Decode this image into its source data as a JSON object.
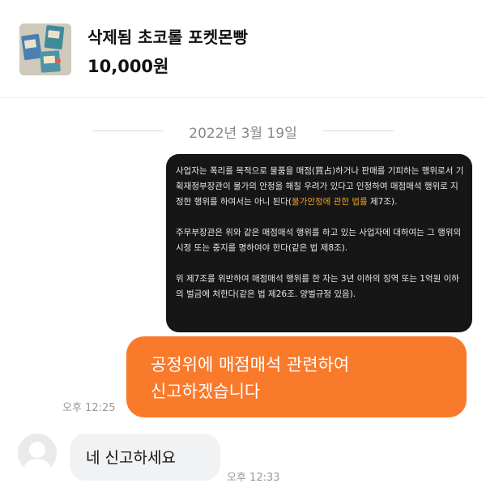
{
  "product": {
    "name": "삭제됨 초코롤 포켓몬빵",
    "price": "10,000원",
    "thumbnail_icon": "product-photo"
  },
  "chat": {
    "date": "2022년 3월 19일",
    "image_message": {
      "paragraph_1_text": "사업자는 폭리를 목적으로 물품을 매점(買占)하거나 판매를 기피하는 행위로서 기획재정부장관이 물가의 안정을 해칠 우려가 있다고 인정하여 매점매석 행위로 지정한 행위를 하여서는 아니 된다(",
      "paragraph_1_highlight": "물가안정에 관한 법률",
      "paragraph_1_end": " 제7조).",
      "paragraph_2": "주무부장관은 위와 같은 매점매석 행위를 하고 있는 사업자에 대하여는 그 행위의 시정 또는 중지를 명하여야 한다(같은 법 제8조).",
      "paragraph_3": "위 제7조를 위반하여 매점매석 행위를 한 자는 3년 이하의 징역 또는 1억원 이하의 벌금에 처한다(같은 법 제26조. 양벌규정 있음).",
      "highlight_color": "#f0a020"
    },
    "sent_message": {
      "line_1": "공정위에 매점매석 관련하여",
      "line_2": "신고하겠습니다",
      "time": "오후 12:25",
      "bubble_color": "#fa7a2b"
    },
    "received_message": {
      "text": "네 신고하세요",
      "time": "오후 12:33",
      "avatar_icon": "default-profile-icon"
    }
  }
}
